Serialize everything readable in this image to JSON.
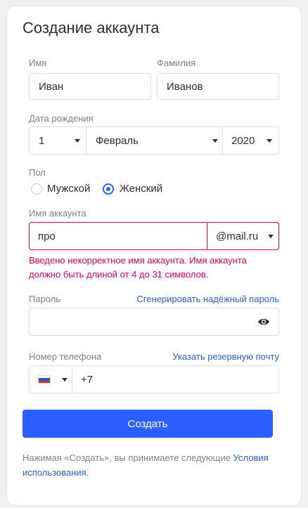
{
  "page": {
    "title": "Создание аккаунта"
  },
  "colors": {
    "accent": "#2c5fff",
    "error": "#e5004e",
    "link": "#2c5fc7"
  },
  "form": {
    "first_name": {
      "label": "Имя",
      "value": "Иван"
    },
    "last_name": {
      "label": "Фамилия",
      "value": "Иванов"
    },
    "birth_date": {
      "label": "Дата рождения",
      "day": "1",
      "month": "Февраль",
      "year": "2020"
    },
    "gender": {
      "label": "Пол",
      "options": [
        "Мужской",
        "Женский"
      ],
      "selected": "Женский"
    },
    "account": {
      "label": "Имя аккаунта",
      "value": "про",
      "domain": "@mail.ru",
      "error_line1": "Введено некорректное имя аккаунта. Имя аккаунта",
      "error_line2": "должно быть длиной от 4 до 31 символов."
    },
    "password": {
      "label": "Пароль",
      "generate_link": "Сгенерировать надёжный пароль",
      "value": "",
      "toggle_icon": "eye-icon"
    },
    "phone": {
      "label": "Номер телефона",
      "alt_link": "Указать резервную почту",
      "country_icon": "russia-flag-icon",
      "value": "+7"
    },
    "submit_label": "Создать",
    "terms_text": "Нажимая «Создать», вы принимаете следующие ",
    "terms_link_1": "Условия",
    "terms_link_2": "использования",
    "terms_end": "."
  }
}
